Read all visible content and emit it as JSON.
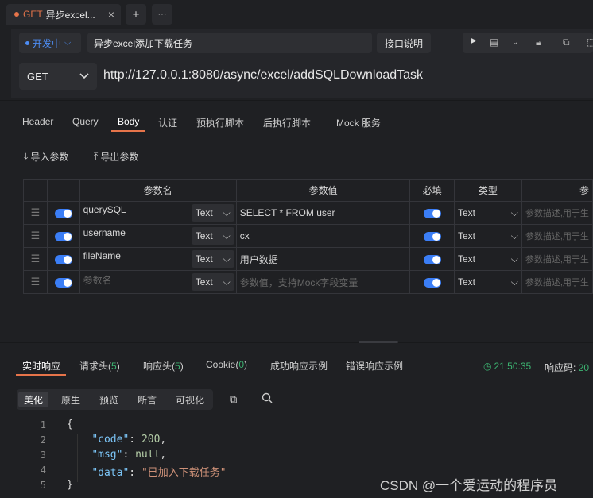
{
  "tab": {
    "method": "GET",
    "title": "异步excel...",
    "close": "×",
    "add": "+",
    "more": "···"
  },
  "env": {
    "label": "开发中",
    "chevron": "⌵"
  },
  "request_name": "异步excel添加下载任务",
  "doc_button": "接口说明",
  "method_select": {
    "value": "GET",
    "chevron": "⌄"
  },
  "url": "http://127.0.0.1:8080/async/excel/addSQLDownloadTask",
  "sub_tabs": [
    "Header",
    "Query",
    "Body",
    "认证",
    "预执行脚本",
    "后执行脚本",
    "Mock 服务"
  ],
  "active_sub_tab": "Body",
  "import_label": "导入参数",
  "export_label": "导出参数",
  "table": {
    "headers": {
      "name": "参数名",
      "value": "参数值",
      "required": "必填",
      "type": "类型",
      "desc": "参"
    },
    "rows": [
      {
        "name": "querySQL",
        "type_sel": "Text",
        "value": "SELECT * FROM user",
        "type": "Text",
        "desc": "参数描述,用于生"
      },
      {
        "name": "username",
        "type_sel": "Text",
        "value": "cx",
        "type": "Text",
        "desc": "参数描述,用于生"
      },
      {
        "name": "fileName",
        "type_sel": "Text",
        "value": "用户数据",
        "type": "Text",
        "desc": "参数描述,用于生"
      }
    ],
    "placeholder_row": {
      "name": "参数名",
      "type_sel": "Text",
      "value": "参数值，支持Mock字段变量",
      "type": "Text",
      "desc": "参数描述,用于生"
    }
  },
  "response": {
    "tabs": {
      "realtime": "实时响应",
      "req_headers": "请求头(",
      "req_headers_count": "5",
      "res_headers": "响应头(",
      "res_headers_count": "5",
      "cookie": "Cookie(",
      "cookie_count": "0",
      "close_paren": ")",
      "success_example": "成功响应示例",
      "error_example": "错误响应示例"
    },
    "time": "21:50:35",
    "code_label": "响应码: ",
    "code_value": "20",
    "view_modes": [
      "美化",
      "原生",
      "预览",
      "断言",
      "可视化"
    ],
    "active_view": "美化",
    "line_numbers": [
      "1",
      "2",
      "3",
      "4",
      "5"
    ],
    "json": {
      "open": "{",
      "k1": "\"code\"",
      "v1": "200",
      "k2": "\"msg\"",
      "v2": "null",
      "k3": "\"data\"",
      "v3": "\"已加入下载任务\"",
      "close": "}"
    }
  },
  "watermark": "CSDN @一个爱运动的程序员",
  "colors": {
    "accent": "#e6744a",
    "toggle": "#3b7ef6",
    "success": "#3cb371",
    "env": "#4d8df5"
  }
}
